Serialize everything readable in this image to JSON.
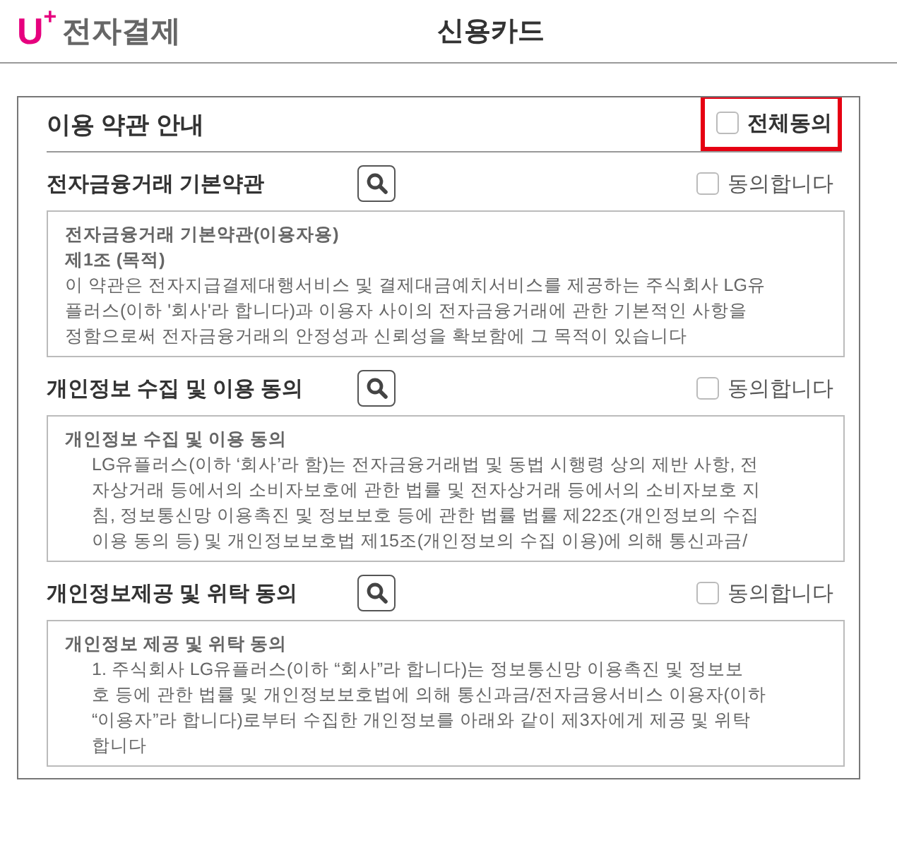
{
  "header": {
    "logo_mark": "U",
    "logo_sup": "+",
    "logo_text": "전자결제",
    "title": "신용카드"
  },
  "terms": {
    "title": "이용 약관 안내",
    "agree_all": {
      "label": "전체동의",
      "checked": false,
      "highlighted": true
    },
    "sections": [
      {
        "title": "전자금융거래 기본약관",
        "agree": {
          "label": "동의합니다",
          "checked": false
        },
        "content": [
          {
            "kind": "heading",
            "text": "전자금융거래 기본약관(이용자용)"
          },
          {
            "kind": "heading",
            "text": "제1조 (목적)"
          },
          {
            "kind": "body",
            "text": "이 약관은 전자지급결제대행서비스 및 결제대금예치서비스를 제공하는 주식회사 LG유"
          },
          {
            "kind": "body",
            "text": "플러스(이하 '회사'라 합니다)과 이용자 사이의 전자금융거래에 관한 기본적인 사항을"
          },
          {
            "kind": "body",
            "text": "정함으로써 전자금융거래의 안정성과 신뢰성을 확보함에 그 목적이 있습니다"
          }
        ]
      },
      {
        "title": "개인정보 수집 및 이용 동의",
        "agree": {
          "label": "동의합니다",
          "checked": false
        },
        "content": [
          {
            "kind": "heading",
            "text": "개인정보 수집 및 이용 동의"
          },
          {
            "kind": "indented",
            "text": "LG유플러스(이하 ‘회사’라 함)는 전자금융거래법 및 동법 시행령 상의 제반 사항, 전"
          },
          {
            "kind": "indented",
            "text": "자상거래 등에서의 소비자보호에 관한 법률 및 전자상거래 등에서의 소비자보호 지"
          },
          {
            "kind": "indented",
            "text": "침, 정보통신망 이용촉진 및 정보보호 등에 관한 법률 법률 제22조(개인정보의 수집"
          },
          {
            "kind": "indented",
            "text": "이용 동의 등) 및 개인정보보호법 제15조(개인정보의 수집 이용)에 의해 통신과금/"
          }
        ]
      },
      {
        "title": "개인정보제공 및 위탁 동의",
        "agree": {
          "label": "동의합니다",
          "checked": false
        },
        "content": [
          {
            "kind": "heading",
            "text": "개인정보 제공 및 위탁 동의"
          },
          {
            "kind": "indented",
            "text": "1. 주식회사 LG유플러스(이하 “회사”라 합니다)는 정보통신망 이용촉진 및 정보보"
          },
          {
            "kind": "indented",
            "text": "호 등에 관한 법률 및 개인정보보호법에 의해 통신과금/전자금융서비스 이용자(이하"
          },
          {
            "kind": "indented",
            "text": "“이용자”라 합니다)로부터 수집한 개인정보를 아래와 같이 제3자에게 제공 및 위탁"
          },
          {
            "kind": "indented",
            "text": "합니다"
          }
        ]
      }
    ]
  }
}
